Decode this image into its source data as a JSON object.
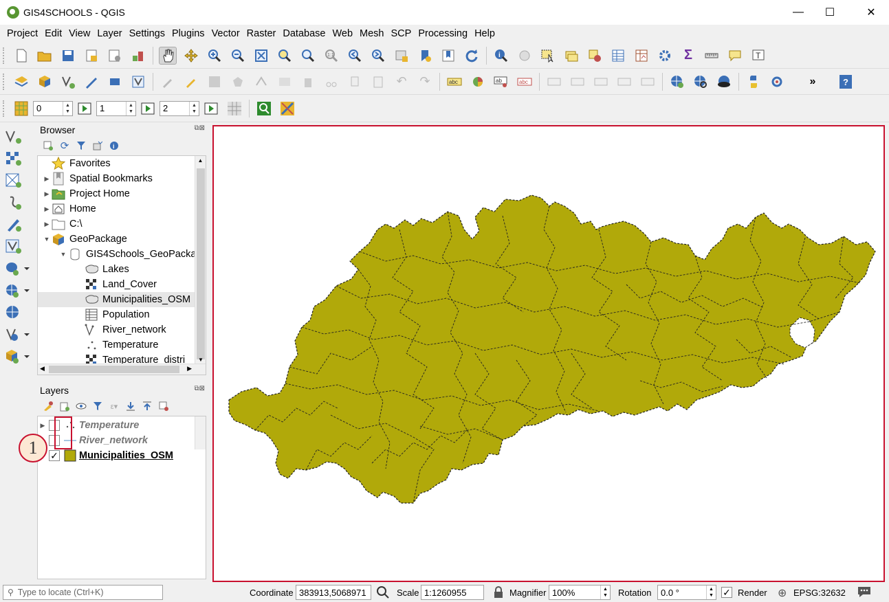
{
  "window": {
    "title": "GIS4SCHOOLS - QGIS",
    "minimize": "—",
    "maximize": "☐",
    "close": "✕"
  },
  "menu": [
    "Project",
    "Edit",
    "View",
    "Layer",
    "Settings",
    "Plugins",
    "Vector",
    "Raster",
    "Database",
    "Web",
    "Mesh",
    "SCP",
    "Processing",
    "Help"
  ],
  "toolbar3": {
    "spin1": "0",
    "spin2": "1",
    "spin3": "2"
  },
  "browser": {
    "title": "Browser",
    "items": [
      {
        "label": "Favorites",
        "icon": "star-icon",
        "indent": 0,
        "arrow": ""
      },
      {
        "label": "Spatial Bookmarks",
        "icon": "bookmark-icon",
        "indent": 0,
        "arrow": "▶"
      },
      {
        "label": "Project Home",
        "icon": "project-home-icon",
        "indent": 0,
        "arrow": "▶"
      },
      {
        "label": "Home",
        "icon": "home-icon",
        "indent": 0,
        "arrow": "▶"
      },
      {
        "label": "C:\\",
        "icon": "folder-icon",
        "indent": 0,
        "arrow": "▶"
      },
      {
        "label": "GeoPackage",
        "icon": "geopackage-icon",
        "indent": 0,
        "arrow": "▼"
      },
      {
        "label": "GIS4Schools_GeoPacka",
        "icon": "database-icon",
        "indent": 1,
        "arrow": "▼"
      },
      {
        "label": "Lakes",
        "icon": "polygon-layer-icon",
        "indent": 2,
        "arrow": ""
      },
      {
        "label": "Land_Cover",
        "icon": "raster-layer-icon",
        "indent": 2,
        "arrow": ""
      },
      {
        "label": "Municipalities_OSM",
        "icon": "polygon-layer-icon",
        "indent": 2,
        "arrow": ""
      },
      {
        "label": "Population",
        "icon": "table-icon",
        "indent": 2,
        "arrow": ""
      },
      {
        "label": "River_network",
        "icon": "line-layer-icon",
        "indent": 2,
        "arrow": ""
      },
      {
        "label": "Temperature",
        "icon": "point-layer-icon",
        "indent": 2,
        "arrow": ""
      },
      {
        "label": "Temperature_distri",
        "icon": "raster-layer-icon",
        "indent": 2,
        "arrow": ""
      }
    ]
  },
  "layers": {
    "title": "Layers",
    "items": [
      {
        "label": "Temperature",
        "checked": false
      },
      {
        "label": "River_network",
        "checked": false
      },
      {
        "label": "Municipalities_OSM",
        "checked": true
      }
    ]
  },
  "callout": "1",
  "status": {
    "locate_placeholder": "Type to locate (Ctrl+K)",
    "coordinate_label": "Coordinate",
    "coordinate": "383913,5068971",
    "scale_label": "Scale",
    "scale": "1:1260955",
    "magnifier_label": "Magnifier",
    "magnifier": "100%",
    "rotation_label": "Rotation",
    "rotation": "0.0 °",
    "render_label": "Render",
    "crs": "EPSG:32632"
  },
  "colors": {
    "map_fill": "#b1a90a",
    "highlight": "#c8102e"
  }
}
